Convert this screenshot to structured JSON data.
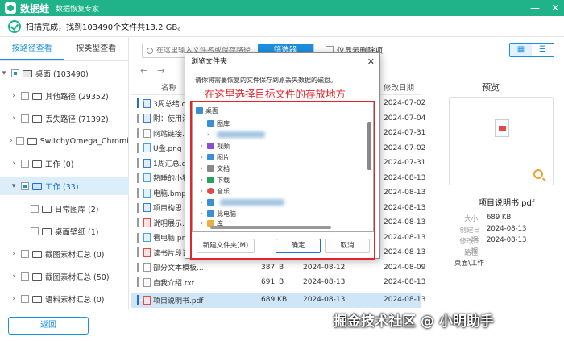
{
  "app": {
    "name": "数据蛙",
    "subtitle": "数据恢复专家"
  },
  "status": {
    "text": "扫描完成，找到103490个文件共13.2 GB。"
  },
  "tabs": {
    "by_path": "按路径查看",
    "by_type": "按类型查看"
  },
  "tree": [
    {
      "label": "桌面 (103490)"
    },
    {
      "label": "其他路径 (29352)"
    },
    {
      "label": "丢失路径 (71392)"
    },
    {
      "label": "SwitchyOmega_Chromium"
    },
    {
      "label": "工作 (0)"
    },
    {
      "label": "工作 (33)"
    },
    {
      "label": "日常图库 (2)"
    },
    {
      "label": "桌面壁纸 (1)"
    },
    {
      "label": "截图素材汇总 (0)"
    },
    {
      "label": "截图素材汇总 (50)"
    },
    {
      "label": "语料素材汇总 (0)"
    }
  ],
  "toolbar": {
    "search_placeholder": "在这里输入文件名或保存路径",
    "filter_label": "筛选器",
    "only_deleted_label": "仅显示删除项"
  },
  "table": {
    "col_name": "名称",
    "col_mdate": "修改日期",
    "rows": [
      {
        "name": "3周总结.do",
        "mdate": "2024-07-02"
      },
      {
        "name": "附：使用注",
        "mdate": "2024-07-04"
      },
      {
        "name": "网站链接.tx",
        "mdate": "2024-07-31"
      },
      {
        "name": "U盘.png",
        "mdate": "2024-07-02"
      },
      {
        "name": "1周汇总.do",
        "mdate": "2024-07-31"
      },
      {
        "name": "熟睡的小猫",
        "mdate": "2024-08-13"
      },
      {
        "name": "电脑.bmp",
        "mdate": "2024-08-13"
      },
      {
        "name": "项目构思.d",
        "mdate": "2024-08-13"
      },
      {
        "name": "说明展示.p",
        "mdate": "2024-08-13"
      },
      {
        "name": "看电脑.png",
        "mdate": "2024-08-13"
      },
      {
        "name": "读书片段记",
        "mdate": "2024-08-13"
      },
      {
        "name": "部分文本模板...",
        "size": "387",
        "unit": "B",
        "cdate": "2024-08-12",
        "mdate": "2024-08-09"
      },
      {
        "name": "自我介绍.txt",
        "size": "691",
        "unit": "B",
        "cdate": "2024-08-13",
        "mdate": "2024-08-13"
      },
      {
        "name": "项目说明书.pdf",
        "size": "689 KB",
        "unit": "",
        "cdate": "2024-08-13",
        "mdate": "2024-08-13"
      }
    ]
  },
  "preview": {
    "title": "预览",
    "filename": "项目说明书.pdf",
    "size_label": "大小:",
    "size": "689 KB",
    "created_label": "创建日期:",
    "created": "2024-08-13",
    "modified_label": "修改日期:",
    "modified": "2024-08-13",
    "path_label": "路径:",
    "path": "桌面\\工作"
  },
  "bottom": {
    "back_label": "返回",
    "watermark": "掘金技术社区 @ 小明助手"
  },
  "dialog": {
    "title": "浏览文件夹",
    "close": "✕",
    "desc": "请你将需要恢复的文件保存到原丢失数据的磁盘。",
    "annotation": "在这里选择目标文件的存放地方",
    "tree": [
      {
        "label": "桌面"
      },
      {
        "label": "图库"
      },
      {
        "label": "视频"
      },
      {
        "label": "图片"
      },
      {
        "label": "文档"
      },
      {
        "label": "下载"
      },
      {
        "label": "音乐"
      },
      {
        "label": "此电脑"
      },
      {
        "label": "库"
      }
    ],
    "new_folder": "新建文件夹(M)",
    "ok": "确定",
    "cancel": "取消"
  },
  "colors": {
    "brand": "#20b38a",
    "accent": "#1d8fe0",
    "annotation": "#e8222b"
  }
}
